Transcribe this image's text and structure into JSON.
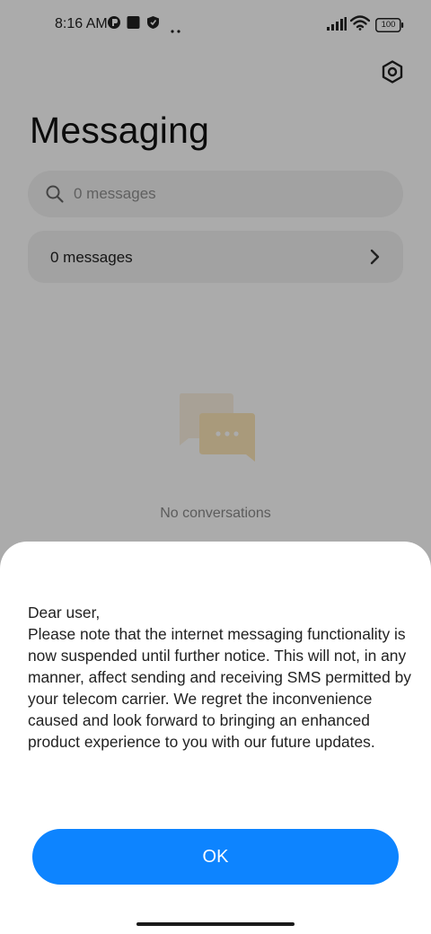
{
  "status_bar": {
    "time": "8:16 AM",
    "battery": "100"
  },
  "header": {
    "title": "Messaging",
    "settings_icon": "settings-hexagon-icon"
  },
  "search": {
    "placeholder": "0 messages"
  },
  "messages_row": {
    "label": "0 messages"
  },
  "empty_state": {
    "text": "No conversations",
    "icon": "chat-bubbles-icon"
  },
  "dialog": {
    "message": "Dear user,\nPlease note that the internet messaging functionality is now suspended until further notice. This will not, in any manner, affect sending and receiving SMS permitted by your telecom carrier. We regret the inconvenience caused and look forward to bringing an enhanced product experience to you with our future updates.",
    "ok_label": "OK"
  },
  "colors": {
    "accent": "#0d84ff",
    "scrim": "rgba(0,0,0,0.33)",
    "card": "#f2f2f2"
  }
}
